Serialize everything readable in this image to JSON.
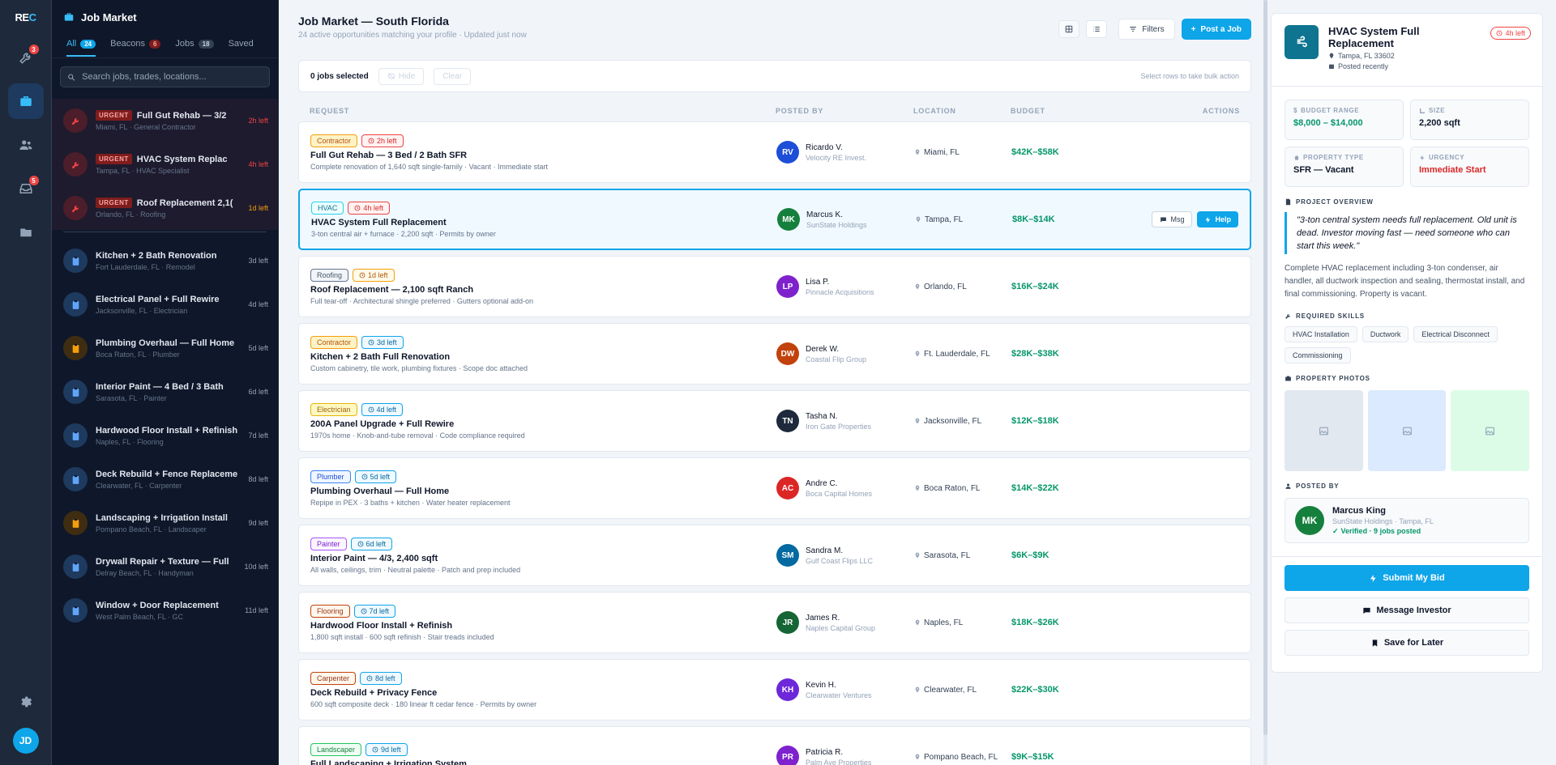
{
  "app": {
    "logo_a": "RE",
    "logo_b": "C",
    "user_initials": "JD"
  },
  "rail": {
    "badge_1": "3",
    "badge_2": "5"
  },
  "listpanel": {
    "title": "Job Market",
    "tabs": [
      {
        "label": "All",
        "count": "24"
      },
      {
        "label": "Beacons",
        "count": "6"
      },
      {
        "label": "Jobs",
        "count": "18"
      },
      {
        "label": "Saved",
        "count": ""
      }
    ],
    "search_placeholder": "Search jobs, trades, locations...",
    "urgent_tag": "URGENT",
    "items": [
      {
        "title": "Full Gut Rehab — 3/2",
        "sub": "Miami, FL · General Contractor",
        "time": "2h left"
      },
      {
        "title": "HVAC System Replac",
        "sub": "Tampa, FL · HVAC Specialist",
        "time": "4h left"
      },
      {
        "title": "Roof Replacement 2,1(",
        "sub": "Orlando, FL · Roofing",
        "time": "1d left"
      },
      {
        "title": "Kitchen + 2 Bath Renovation",
        "sub": "Fort Lauderdale, FL · Remodel",
        "time": "3d left"
      },
      {
        "title": "Electrical Panel + Full Rewire",
        "sub": "Jacksonville, FL · Electrician",
        "time": "4d left"
      },
      {
        "title": "Plumbing Overhaul — Full Home",
        "sub": "Boca Raton, FL · Plumber",
        "time": "5d left"
      },
      {
        "title": "Interior Paint — 4 Bed / 3 Bath",
        "sub": "Sarasota, FL · Painter",
        "time": "6d left"
      },
      {
        "title": "Hardwood Floor Install + Refinish",
        "sub": "Naples, FL · Flooring",
        "time": "7d left"
      },
      {
        "title": "Deck Rebuild + Fence Replaceme",
        "sub": "Clearwater, FL · Carpenter",
        "time": "8d left"
      },
      {
        "title": "Landscaping + Irrigation Install",
        "sub": "Pompano Beach, FL · Landscaper",
        "time": "9d left"
      },
      {
        "title": "Drywall Repair + Texture — Full",
        "sub": "Delray Beach, FL · Handyman",
        "time": "10d left"
      },
      {
        "title": "Window + Door Replacement",
        "sub": "West Palm Beach, FL · GC",
        "time": "11d left"
      }
    ]
  },
  "main": {
    "title": "Job Market — South Florida",
    "subtitle": "24 active opportunities matching your profile · Updated just now",
    "filters": "Filters",
    "post": "Post a Job",
    "bulk": {
      "selected": "0 jobs selected",
      "hide": "Hide",
      "clear": "Clear",
      "hint": "Select rows to take bulk action"
    },
    "headers": {
      "request": "REQUEST",
      "posted_by": "POSTED BY",
      "location": "LOCATION",
      "budget": "BUDGET",
      "actions": "ACTIONS"
    },
    "msg": "Msg",
    "help": "Help",
    "rows": [
      {
        "trade": "Contractor",
        "time": "2h left",
        "title": "Full Gut Rehab — 3 Bed / 2 Bath SFR",
        "desc": "Complete renovation of 1,640 sqft single-family · Vacant · Immediate start",
        "initials": "RV",
        "name": "Ricardo V.",
        "company": "Velocity RE Invest.",
        "location": "Miami, FL",
        "budget": "$42K–$58K"
      },
      {
        "trade": "HVAC",
        "time": "4h left",
        "title": "HVAC System Full Replacement",
        "desc": "3-ton central air + furnace · 2,200 sqft · Permits by owner",
        "initials": "MK",
        "name": "Marcus K.",
        "company": "SunState Holdings",
        "location": "Tampa, FL",
        "budget": "$8K–$14K"
      },
      {
        "trade": "Roofing",
        "time": "1d left",
        "title": "Roof Replacement — 2,100 sqft Ranch",
        "desc": "Full tear-off · Architectural shingle preferred · Gutters optional add-on",
        "initials": "LP",
        "name": "Lisa P.",
        "company": "Pinnacle Acquisitions",
        "location": "Orlando, FL",
        "budget": "$16K–$24K"
      },
      {
        "trade": "Contractor",
        "time": "3d left",
        "title": "Kitchen + 2 Bath Full Renovation",
        "desc": "Custom cabinetry, tile work, plumbing fixtures · Scope doc attached",
        "initials": "DW",
        "name": "Derek W.",
        "company": "Coastal Flip Group",
        "location": "Ft. Lauderdale, FL",
        "budget": "$28K–$38K"
      },
      {
        "trade": "Electrician",
        "time": "4d left",
        "title": "200A Panel Upgrade + Full Rewire",
        "desc": "1970s home · Knob-and-tube removal · Code compliance required",
        "initials": "TN",
        "name": "Tasha N.",
        "company": "Iron Gate Properties",
        "location": "Jacksonville, FL",
        "budget": "$12K–$18K"
      },
      {
        "trade": "Plumber",
        "time": "5d left",
        "title": "Plumbing Overhaul — Full Home",
        "desc": "Repipe in PEX · 3 baths + kitchen · Water heater replacement",
        "initials": "AC",
        "name": "Andre C.",
        "company": "Boca Capital Homes",
        "location": "Boca Raton, FL",
        "budget": "$14K–$22K"
      },
      {
        "trade": "Painter",
        "time": "6d left",
        "title": "Interior Paint — 4/3, 2,400 sqft",
        "desc": "All walls, ceilings, trim · Neutral palette · Patch and prep included",
        "initials": "SM",
        "name": "Sandra M.",
        "company": "Gulf Coast Flips LLC",
        "location": "Sarasota, FL",
        "budget": "$6K–$9K"
      },
      {
        "trade": "Flooring",
        "time": "7d left",
        "title": "Hardwood Floor Install + Refinish",
        "desc": "1,800 sqft install · 600 sqft refinish · Stair treads included",
        "initials": "JR",
        "name": "James R.",
        "company": "Naples Capital Group",
        "location": "Naples, FL",
        "budget": "$18K–$26K"
      },
      {
        "trade": "Carpenter",
        "time": "8d left",
        "title": "Deck Rebuild + Privacy Fence",
        "desc": "600 sqft composite deck · 180 linear ft cedar fence · Permits by owner",
        "initials": "KH",
        "name": "Kevin H.",
        "company": "Clearwater Ventures",
        "location": "Clearwater, FL",
        "budget": "$22K–$30K"
      },
      {
        "trade": "Landscaper",
        "time": "9d left",
        "title": "Full Landscaping + Irrigation System",
        "desc": "",
        "initials": "PR",
        "name": "Patricia R.",
        "company": "Palm Ave Properties",
        "location": "Pompano Beach, FL",
        "budget": "$9K–$15K"
      }
    ]
  },
  "detail": {
    "title": "HVAC System Full Replacement",
    "location": "Tampa, FL 33602",
    "posted": "Posted recently",
    "badge": "4h left",
    "stats": [
      {
        "label": "BUDGET RANGE",
        "value": "$8,000 – $14,000"
      },
      {
        "label": "SIZE",
        "value": "2,200 sqft"
      },
      {
        "label": "PROPERTY TYPE",
        "value": "SFR — Vacant"
      },
      {
        "label": "URGENCY",
        "value": "Immediate Start"
      }
    ],
    "overview_label": "PROJECT OVERVIEW",
    "quote": "\"3-ton central system needs full replacement. Old unit is dead. Investor moving fast — need someone who can start this week.\"",
    "description": "Complete HVAC replacement including 3-ton condenser, air handler, all ductwork inspection and sealing, thermostat install, and final commissioning. Property is vacant.",
    "skills_label": "REQUIRED SKILLS",
    "skills": [
      "HVAC Installation",
      "Ductwork",
      "Electrical Disconnect",
      "Commissioning"
    ],
    "photos_label": "PROPERTY PHOTOS",
    "posted_by_label": "POSTED BY",
    "poster": {
      "initials": "MK",
      "name": "Marcus King",
      "company": "SunState Holdings · Tampa, FL",
      "verified": "Verified · 9 jobs posted"
    },
    "submit": "Submit My Bid",
    "message": "Message Investor",
    "save": "Save for Later"
  }
}
